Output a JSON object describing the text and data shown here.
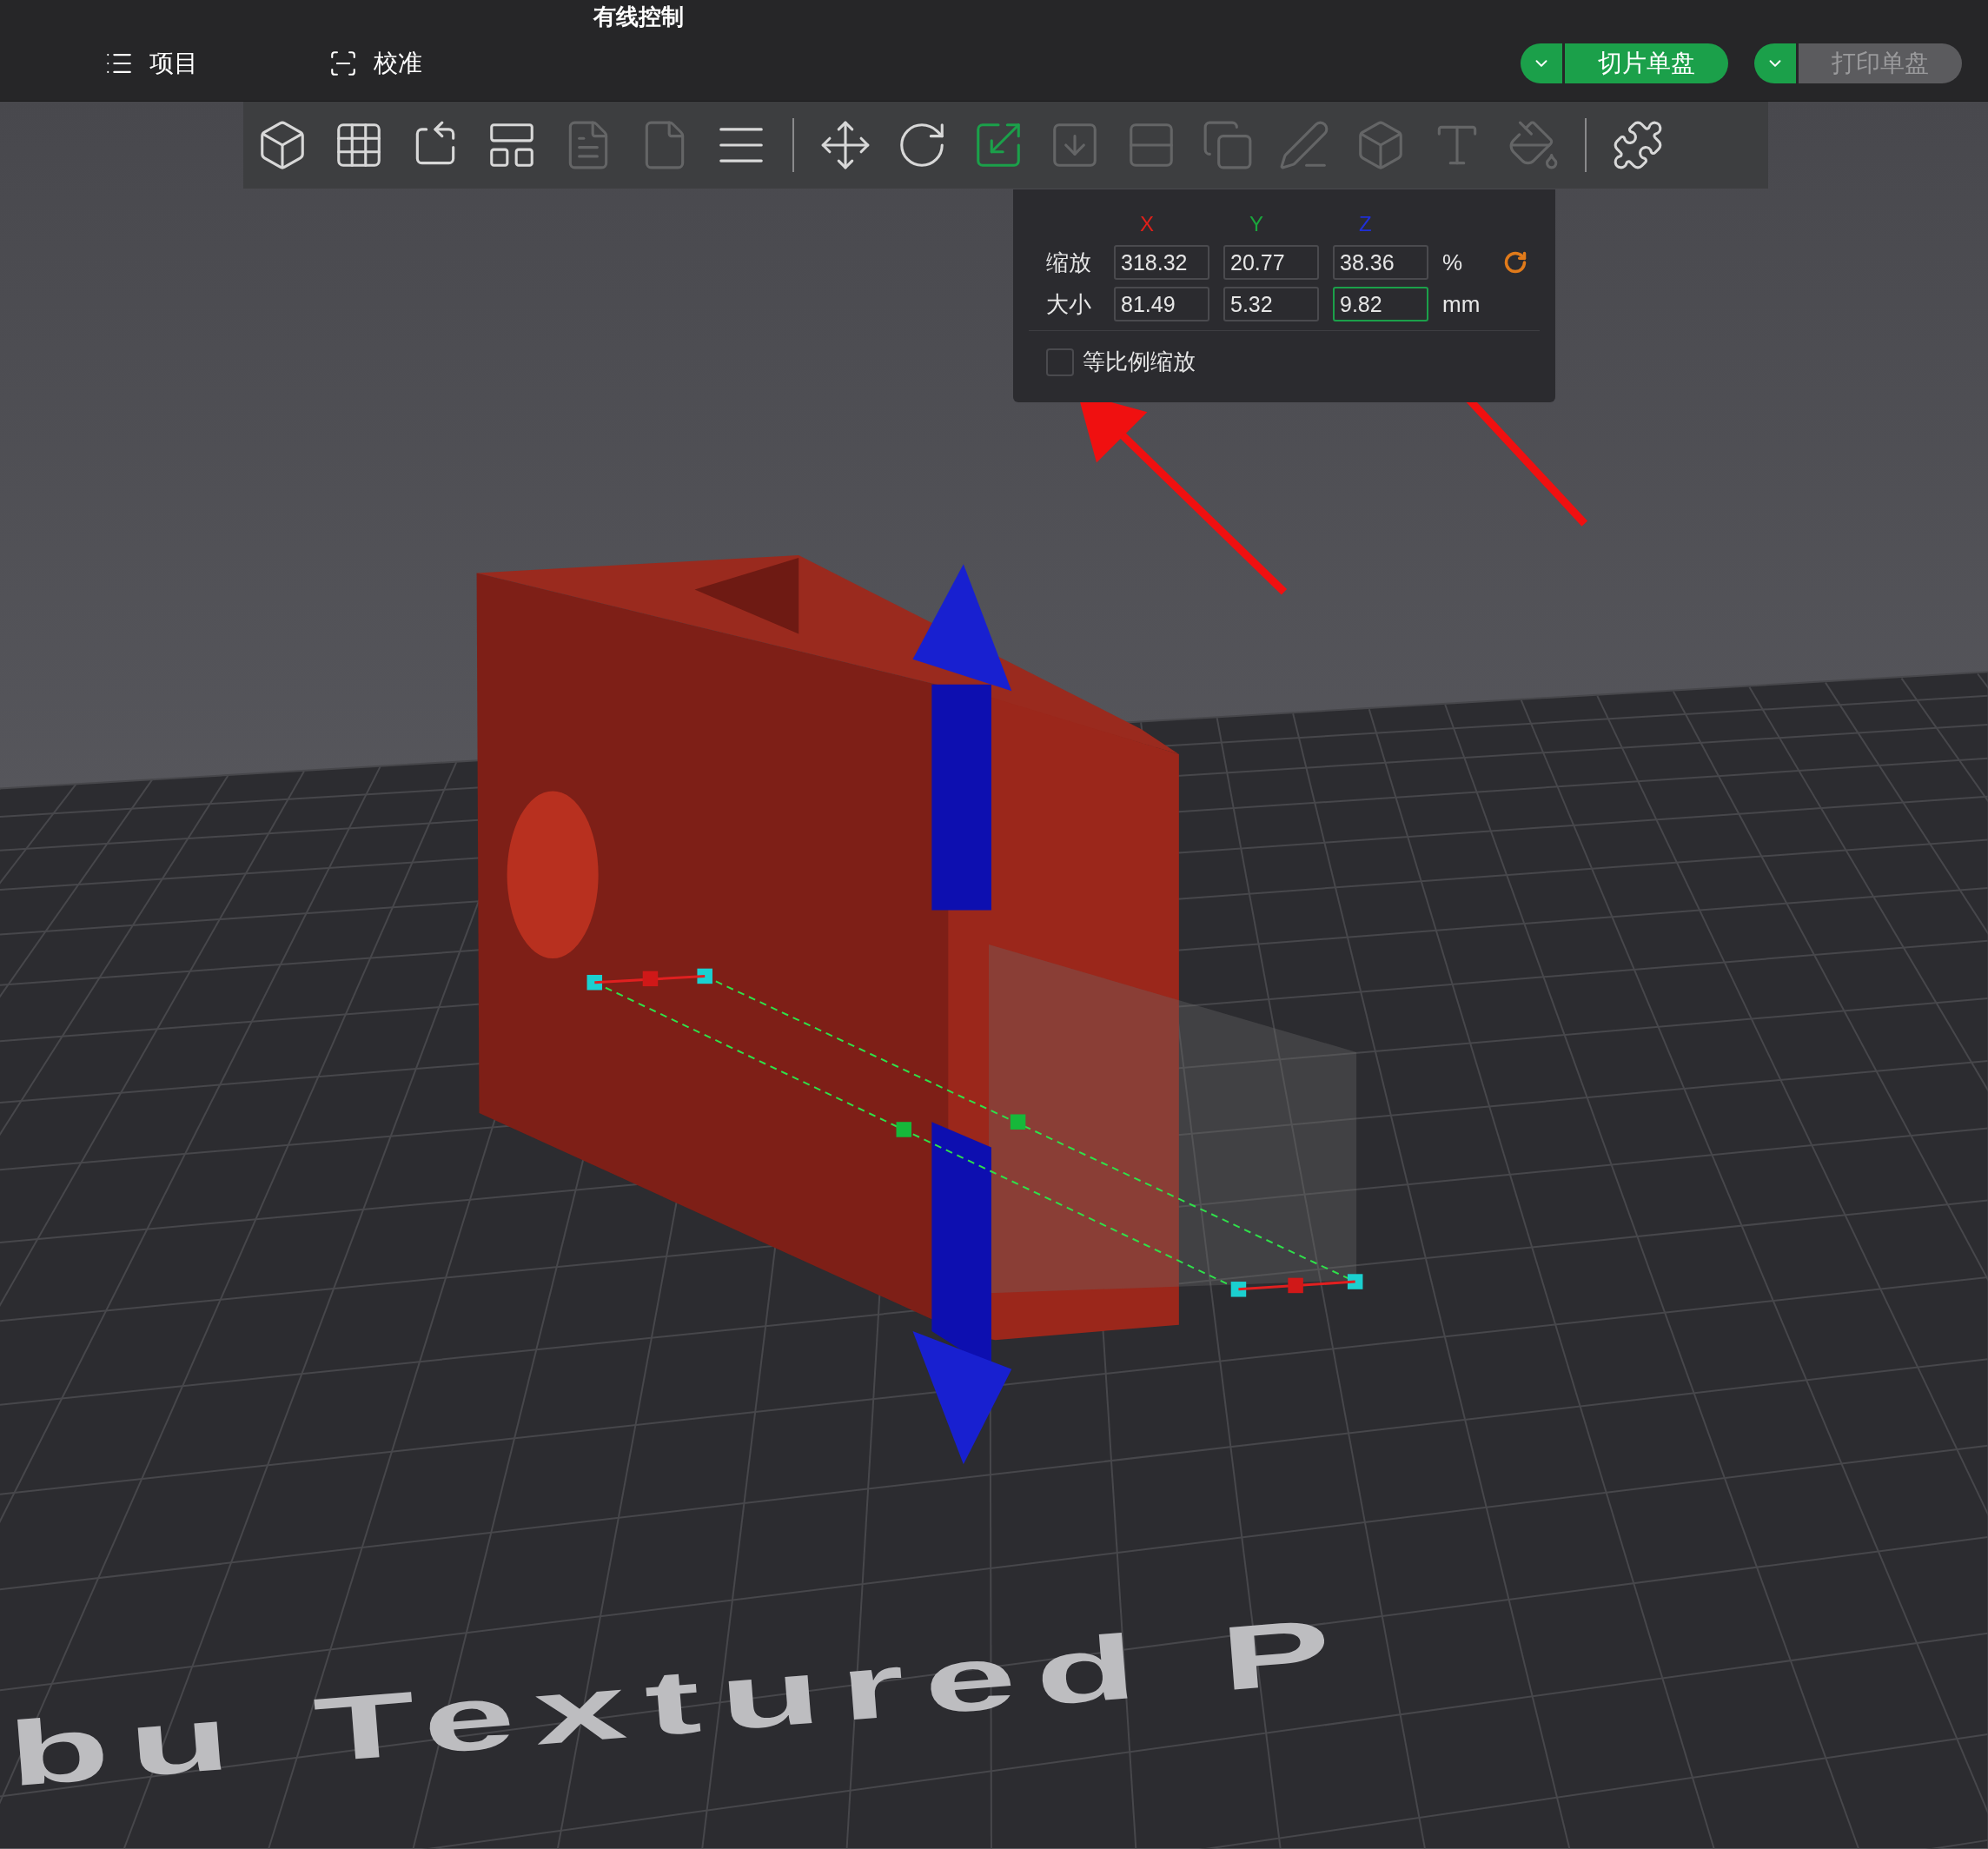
{
  "window": {
    "title": "有线控制"
  },
  "nav": [
    {
      "label": "项目",
      "kind": "project"
    },
    {
      "label": "校准",
      "kind": "calibrate"
    }
  ],
  "actions": [
    {
      "label": "切片单盘",
      "disabled": false
    },
    {
      "label": "打印单盘",
      "disabled": true
    }
  ],
  "toolbar": [
    {
      "disabled": false,
      "selected": false
    },
    {
      "disabled": false,
      "selected": false
    },
    {
      "disabled": false,
      "selected": false
    },
    {
      "disabled": false,
      "selected": false
    },
    {
      "disabled": true,
      "selected": false
    },
    {
      "disabled": true,
      "selected": false
    },
    {
      "disabled": false,
      "selected": false
    },
    {
      "disabled": false,
      "selected": false
    },
    {
      "disabled": false,
      "selected": false
    },
    {
      "disabled": false,
      "selected": true
    },
    {
      "disabled": true,
      "selected": false
    },
    {
      "disabled": true,
      "selected": false
    },
    {
      "disabled": true,
      "selected": false
    },
    {
      "disabled": true,
      "selected": false
    },
    {
      "disabled": true,
      "selected": false
    },
    {
      "disabled": true,
      "selected": false
    },
    {
      "disabled": true,
      "selected": false
    },
    {
      "disabled": false,
      "selected": false
    }
  ],
  "scale_panel": {
    "columns": [
      {
        "label": "X",
        "color": "#e0201a"
      },
      {
        "label": "Y",
        "color": "#1aa53c"
      },
      {
        "label": "Z",
        "color": "#1f2fd8"
      }
    ],
    "rows": [
      {
        "label": "缩放",
        "values": [
          {
            "value": "318.32",
            "focused": false
          },
          {
            "value": "20.77",
            "focused": false
          },
          {
            "value": "38.36",
            "focused": false
          }
        ],
        "unit": "%",
        "reset": true
      },
      {
        "label": "大小",
        "values": [
          {
            "value": "81.49",
            "focused": false
          },
          {
            "value": "5.32",
            "focused": false
          },
          {
            "value": "9.82",
            "focused": true
          }
        ],
        "unit": "mm"
      }
    ],
    "uniform": {
      "label": "等比例缩放",
      "checked": false
    }
  },
  "bed_label": "bu Textured P"
}
